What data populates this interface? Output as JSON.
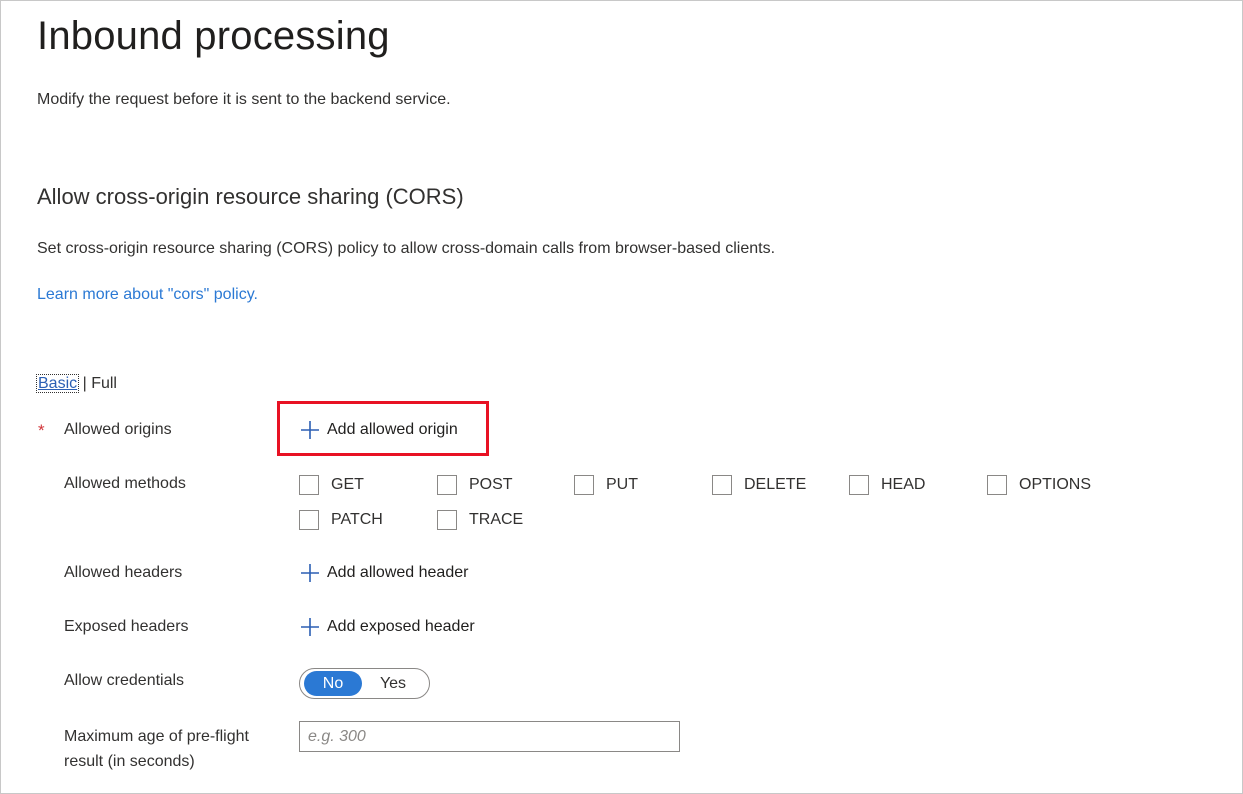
{
  "header": {
    "title": "Inbound processing",
    "subtitle": "Modify the request before it is sent to the backend service."
  },
  "cors": {
    "title": "Allow cross-origin resource sharing (CORS)",
    "description": "Set cross-origin resource sharing (CORS) policy to allow cross-domain calls from browser-based clients.",
    "learn_more": "Learn more about \"cors\" policy.",
    "mode": {
      "basic": "Basic",
      "separator": "|",
      "full": "Full",
      "selected": "Basic"
    },
    "required_marker": "*",
    "allowed_origins": {
      "label": "Allowed origins",
      "add_label": "Add allowed origin"
    },
    "allowed_methods": {
      "label": "Allowed methods",
      "options": [
        "GET",
        "POST",
        "PUT",
        "DELETE",
        "HEAD",
        "OPTIONS",
        "PATCH",
        "TRACE"
      ],
      "checked": []
    },
    "allowed_headers": {
      "label": "Allowed headers",
      "add_label": "Add allowed header"
    },
    "exposed_headers": {
      "label": "Exposed headers",
      "add_label": "Add exposed header"
    },
    "allow_credentials": {
      "label": "Allow credentials",
      "options": [
        "No",
        "Yes"
      ],
      "selected": "No"
    },
    "max_age": {
      "label": "Maximum age of pre-flight result (in seconds)",
      "placeholder": "e.g. 300",
      "value": ""
    }
  },
  "colors": {
    "accent": "#2b79d4",
    "highlight": "#e81123",
    "required": "#d13438"
  },
  "icons": {
    "add": "plus-icon"
  }
}
